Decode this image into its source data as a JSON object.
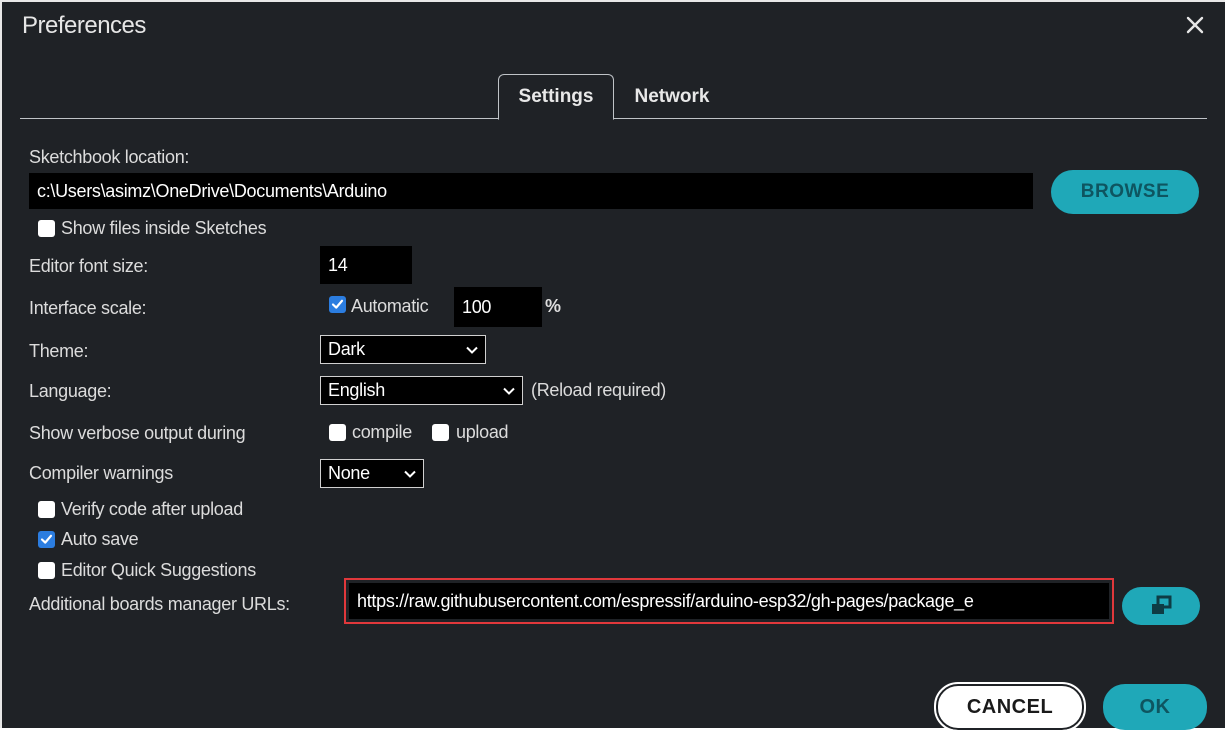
{
  "window": {
    "title": "Preferences"
  },
  "tabs": [
    {
      "label": "Settings",
      "active": true
    },
    {
      "label": "Network",
      "active": false
    }
  ],
  "sketchbook": {
    "label": "Sketchbook location:",
    "value": "c:\\Users\\asimz\\OneDrive\\Documents\\Arduino",
    "browse_label": "BROWSE"
  },
  "show_files": {
    "label": "Show files inside Sketches",
    "checked": false
  },
  "font_size": {
    "label": "Editor font size:",
    "value": "14"
  },
  "interface_scale": {
    "label": "Interface scale:",
    "automatic_label": "Automatic",
    "automatic_checked": true,
    "value": "100",
    "unit": "%"
  },
  "theme": {
    "label": "Theme:",
    "value": "Dark"
  },
  "language": {
    "label": "Language:",
    "value": "English",
    "note": "(Reload required)"
  },
  "verbose": {
    "label": "Show verbose output during",
    "compile_label": "compile",
    "compile_checked": false,
    "upload_label": "upload",
    "upload_checked": false
  },
  "compiler_warnings": {
    "label": "Compiler warnings",
    "value": "None"
  },
  "verify_code": {
    "label": "Verify code after upload",
    "checked": false
  },
  "auto_save": {
    "label": "Auto save",
    "checked": true
  },
  "quick_suggestions": {
    "label": "Editor Quick Suggestions",
    "checked": false
  },
  "boards_urls": {
    "label": "Additional boards manager URLs:",
    "value": "https://raw.githubusercontent.com/espressif/arduino-esp32/gh-pages/package_e"
  },
  "footer": {
    "cancel_label": "CANCEL",
    "ok_label": "OK"
  },
  "colors": {
    "background": "#1f2226",
    "accent": "#1fa8b8",
    "checkbox_checked": "#2b7de0",
    "highlight": "#e0383b"
  }
}
